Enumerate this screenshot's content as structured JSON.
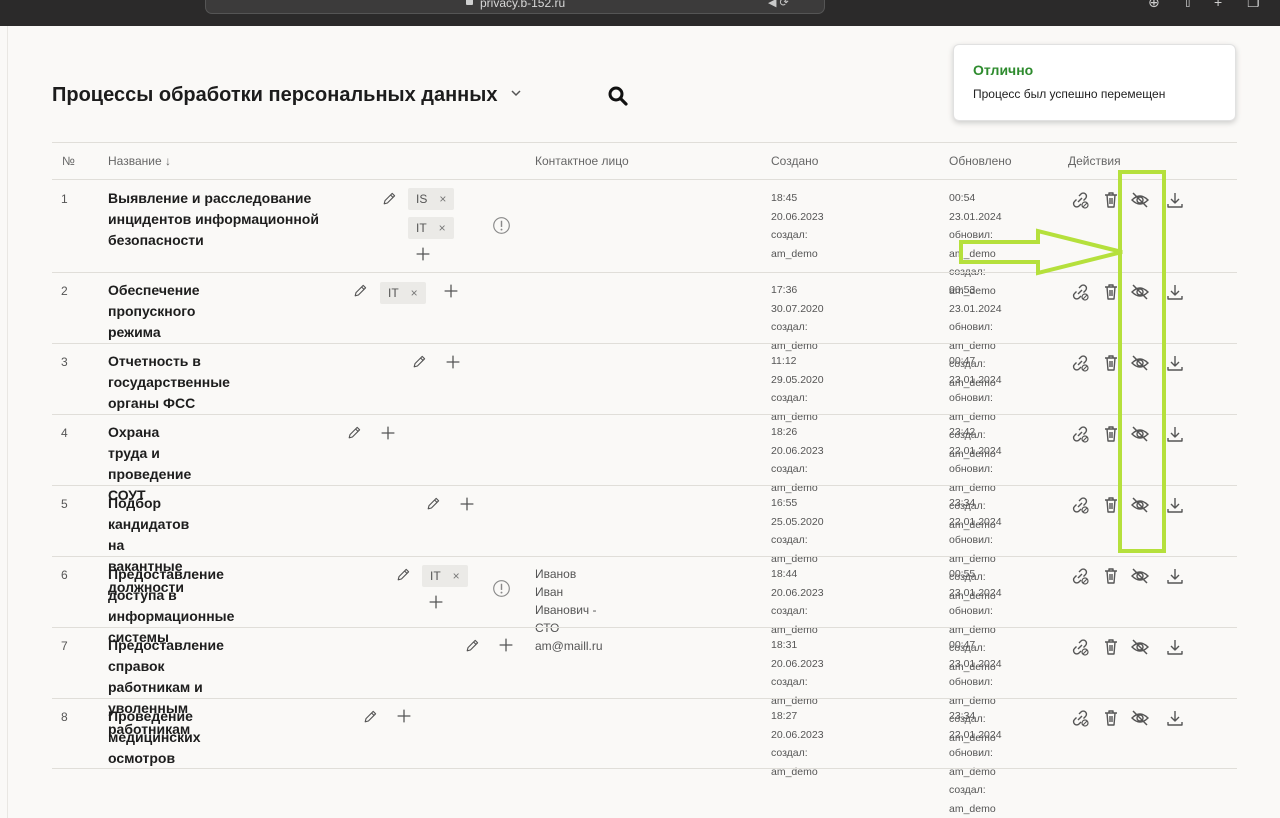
{
  "browser": {
    "url": "privacy.b-152.ru"
  },
  "page": {
    "title": "Процессы обработки персональных данных"
  },
  "toast": {
    "title": "Отлично",
    "message": "Процесс был успешно перемещен"
  },
  "table": {
    "headers": {
      "num": "№",
      "name": "Название ↓",
      "contact": "Контактное лицо",
      "created": "Создано",
      "updated": "Обновлено",
      "actions": "Действия"
    },
    "rows": [
      {
        "num": "1",
        "name_lines": [
          "Выявление и расследование",
          "инцидентов информационной",
          "безопасности"
        ],
        "tags": [
          "IS",
          "IT"
        ],
        "contact": [
          "",
          ""
        ],
        "created": [
          "18:45 20.06.2023",
          "создал: am_demo"
        ],
        "updated": [
          "00:54 23.01.2024",
          "обновил: am_demo",
          "создал: am_demo"
        ]
      },
      {
        "num": "2",
        "name_lines": [
          "Обеспечение пропускного режима"
        ],
        "tags": [
          "IT"
        ],
        "contact": [
          "",
          ""
        ],
        "created": [
          "17:36 30.07.2020",
          "создал: am_demo"
        ],
        "updated": [
          "00:53 23.01.2024",
          "обновил: am_demo",
          "создал: am_demo"
        ]
      },
      {
        "num": "3",
        "name_lines": [
          "Отчетность в государственные органы ФСС"
        ],
        "tags": [],
        "contact": [
          "",
          ""
        ],
        "created": [
          "11:12 29.05.2020",
          "создал: am_demo"
        ],
        "updated": [
          "00:47 23.01.2024",
          "обновил: am_demo",
          "создал: am_demo"
        ]
      },
      {
        "num": "4",
        "name_lines": [
          "Охрана труда и проведение СОУТ"
        ],
        "tags": [],
        "contact": [
          "",
          ""
        ],
        "created": [
          "18:26 20.06.2023",
          "создал: am_demo"
        ],
        "updated": [
          "23:42 22.01.2024",
          "обновил: am_demo",
          "создал: am_demo"
        ]
      },
      {
        "num": "5",
        "name_lines": [
          "Подбор кандидатов на вакантные должности"
        ],
        "tags": [],
        "contact": [
          "",
          ""
        ],
        "created": [
          "16:55 25.05.2020",
          "создал: am_demo"
        ],
        "updated": [
          "23:34 22.01.2024",
          "обновил: am_demo",
          "создал: am_demo"
        ]
      },
      {
        "num": "6",
        "name_lines": [
          "Предоставление доступа в",
          "информационные системы"
        ],
        "tags": [
          "IT"
        ],
        "contact": [
          "Иванов Иван Иванович - СТО",
          "am@maill.ru"
        ],
        "created": [
          "18:44 20.06.2023",
          "создал: am_demo"
        ],
        "updated": [
          "00:55 23.01.2024",
          "обновил: am_demo",
          "создал: am_demo"
        ]
      },
      {
        "num": "7",
        "name_lines": [
          "Предоставление справок работникам и уволенным",
          "работникам"
        ],
        "tags": [],
        "contact": [
          "",
          ""
        ],
        "created": [
          "18:31 20.06.2023",
          "создал: am_demo"
        ],
        "updated": [
          "00:47 23.01.2024",
          "обновил: am_demo",
          "создал: am_demo"
        ]
      },
      {
        "num": "8",
        "name_lines": [
          "Проведение медицинских осмотров"
        ],
        "tags": [],
        "contact": [
          "",
          ""
        ],
        "created": [
          "18:27 20.06.2023",
          "создал: am_demo"
        ],
        "updated": [
          "23:34 22.01.2024",
          "обновил: am_demo",
          "создал: am_demo"
        ]
      }
    ]
  },
  "icons": {
    "tag_remove": "close-icon",
    "add_tag": "plus-icon",
    "edit": "pencil-icon",
    "info": "info-circle-icon",
    "actions": [
      "link-icon",
      "trash-icon",
      "eye-off-icon",
      "download-icon"
    ]
  },
  "annotation": {
    "color": "#b5e03c"
  }
}
